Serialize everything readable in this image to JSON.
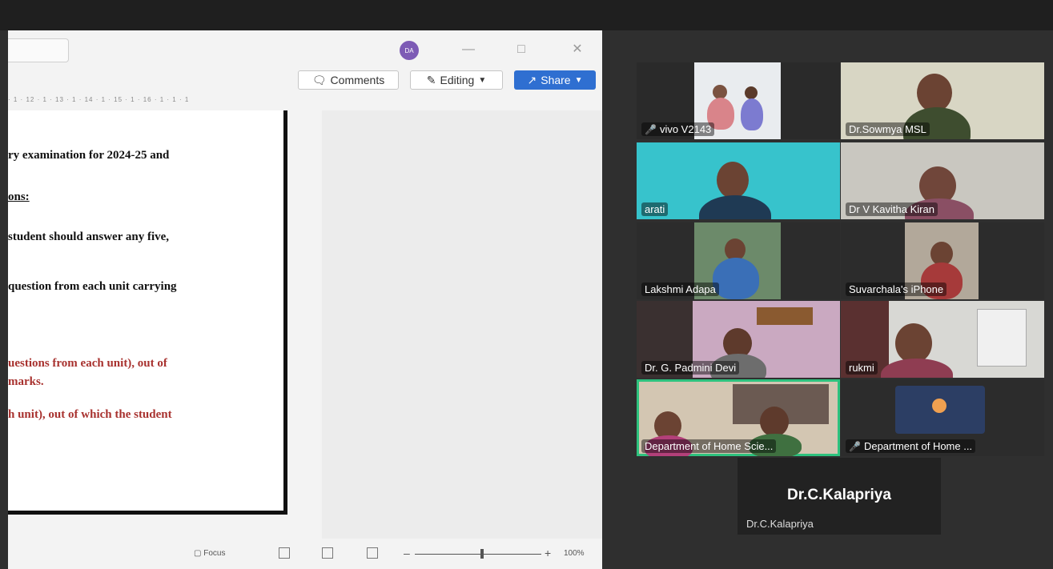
{
  "word": {
    "avatar_initials": "DA",
    "buttons": {
      "comments": "Comments",
      "editing": "Editing",
      "share": "Share"
    },
    "ruler": "· 1 · 12 · 1 · 13 · 1 · 14 · 1 · 15 · 1 · 16 · 1 · 1 · 1",
    "document_lines": [
      "ry examination for 2024-25 and",
      "ons:",
      "student should answer any five,",
      "question from each unit carrying",
      "uestions from each unit), out of",
      "marks.",
      "h unit), out of which the student"
    ],
    "statusbar": {
      "focus": "Focus",
      "zoom": "100%"
    }
  },
  "meeting": {
    "tiles": [
      {
        "name": "vivo V2143",
        "muted": true
      },
      {
        "name": "Dr.Sowmya MSL",
        "muted": false
      },
      {
        "name": "arati",
        "muted": false
      },
      {
        "name": "Dr V Kavitha Kiran",
        "muted": false
      },
      {
        "name": "Lakshmi Adapa",
        "muted": false
      },
      {
        "name": "Suvarchala's iPhone",
        "muted": false
      },
      {
        "name": "Dr. G. Padmini Devi",
        "muted": false
      },
      {
        "name": "rukmi",
        "muted": false
      },
      {
        "name": "Department of Home Scie...",
        "muted": false
      },
      {
        "name": "Department of Home ...",
        "muted": true
      }
    ],
    "active_speaker": {
      "big_name": "Dr.C.Kalapriya",
      "small_name": "Dr.C.Kalapriya"
    }
  },
  "colors": {
    "share_blue": "#2f6fd1",
    "active_border": "#2ec27e",
    "mute_red": "#e2332f",
    "doc_red": "#a8322f"
  }
}
